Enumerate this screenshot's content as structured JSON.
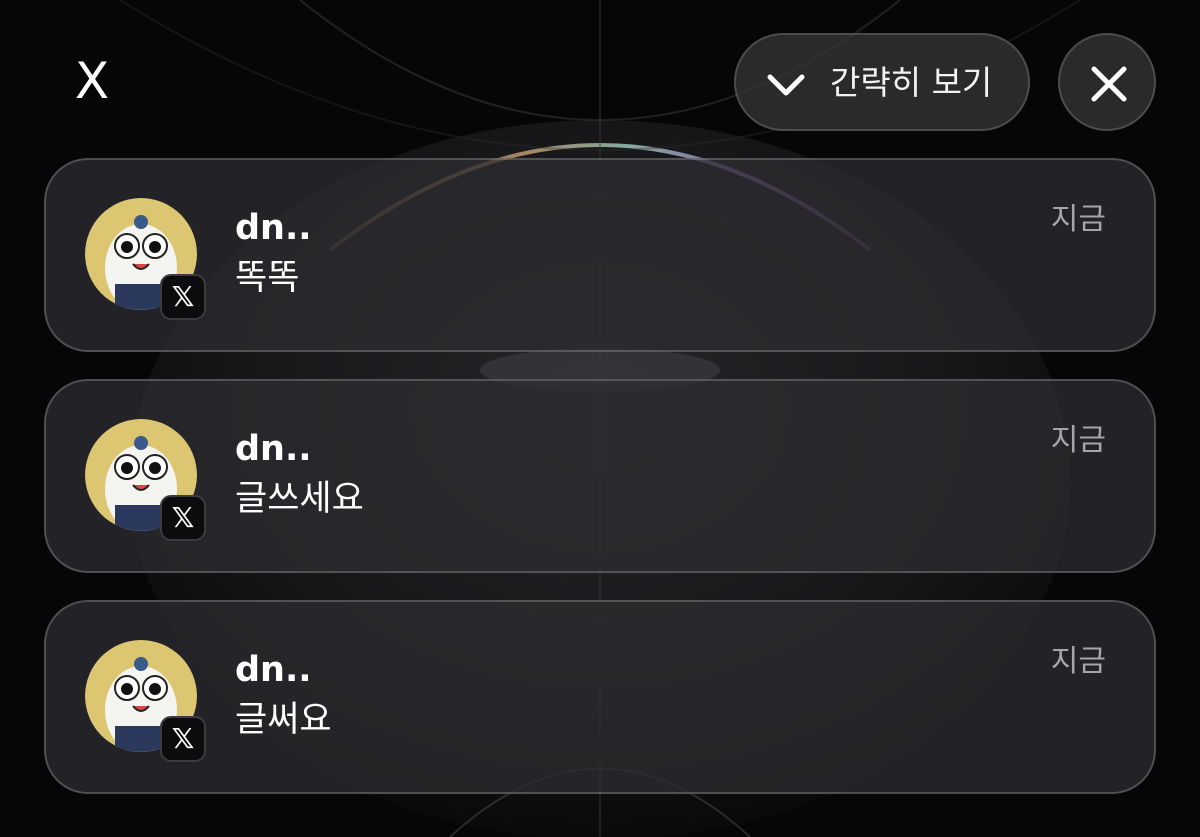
{
  "header": {
    "close_x_label": "X",
    "collapse_label": "간략히 보기",
    "collapse_icon": "chevron-down-icon",
    "close_icon": "close-icon"
  },
  "notifications": [
    {
      "sender": "dn..",
      "message": "똑똑",
      "time": "지금",
      "app_badge": "𝕏",
      "app_icon": "x-app-icon"
    },
    {
      "sender": "dn..",
      "message": "글쓰세요",
      "time": "지금",
      "app_badge": "𝕏",
      "app_icon": "x-app-icon"
    },
    {
      "sender": "dn..",
      "message": "글써요",
      "time": "지금",
      "app_badge": "𝕏",
      "app_icon": "x-app-icon"
    }
  ],
  "colors": {
    "background": "#060608",
    "card": "#2e2e32",
    "text": "#ffffff",
    "secondary_text": "#a5a5aa",
    "avatar_bg": "#f0d77a"
  }
}
